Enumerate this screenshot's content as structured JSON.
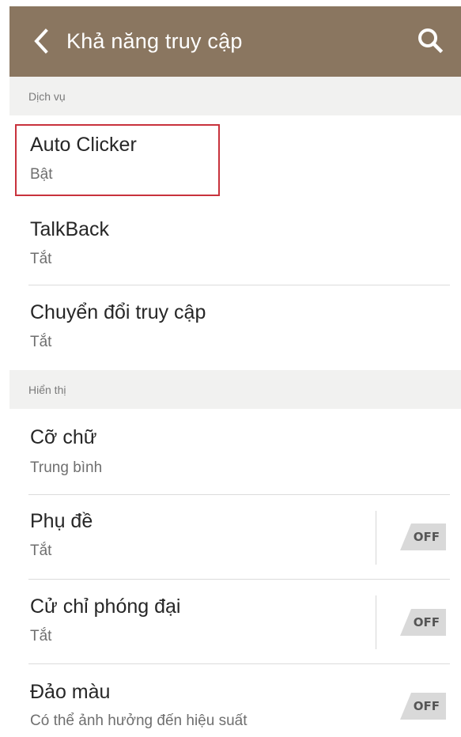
{
  "header": {
    "title": "Khả năng truy cập",
    "back_icon": "chevron-left-icon",
    "search_icon": "search-icon",
    "background": "#8a7660"
  },
  "sections": [
    {
      "title": "Dịch vụ",
      "items": [
        {
          "label": "Auto Clicker",
          "sub": "Bật",
          "highlighted": true
        },
        {
          "label": "TalkBack",
          "sub": "Tắt"
        },
        {
          "label": "Chuyển đổi truy cập",
          "sub": "Tắt"
        }
      ]
    },
    {
      "title": "Hiển thị",
      "items": [
        {
          "label": "Cỡ chữ",
          "sub": "Trung bình"
        },
        {
          "label": "Phụ đề",
          "sub": "Tắt",
          "toggle": "OFF"
        },
        {
          "label": "Cử chỉ phóng đại",
          "sub": "Tắt",
          "toggle": "OFF"
        },
        {
          "label": "Đảo màu",
          "sub": "Có thể ảnh hưởng đến hiệu suất",
          "toggle": "OFF"
        }
      ]
    }
  ],
  "colors": {
    "highlight_border": "#c8323c",
    "section_bg": "#f1f1f0",
    "toggle_bg": "#d9d9d9"
  }
}
